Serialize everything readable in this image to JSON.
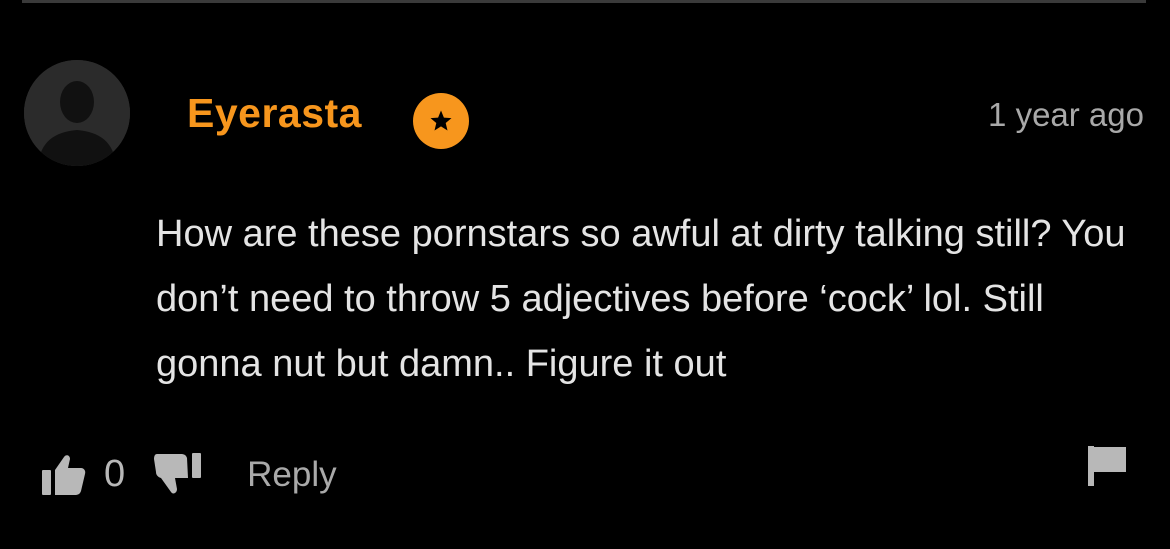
{
  "comment": {
    "author": "Eyerasta",
    "timestamp": "1 year ago",
    "body": "How are these pornstars so awful at dirty talking still? You don’t need to throw 5 adjectives before ‘cock’ lol. Still gonna nut but damn.. Figure it out",
    "like_count": "0",
    "reply_label": "Reply"
  },
  "icons": {
    "avatar": "default-user-silhouette-icon",
    "badge": "star-icon",
    "like": "thumbs-up-icon",
    "dislike": "thumbs-down-icon",
    "report": "flag-icon"
  },
  "colors": {
    "background": "#000000",
    "username": "#f7961d",
    "badge": "#f7961d",
    "body_text": "#e4e4e4",
    "muted_text": "#a9a9a9"
  }
}
